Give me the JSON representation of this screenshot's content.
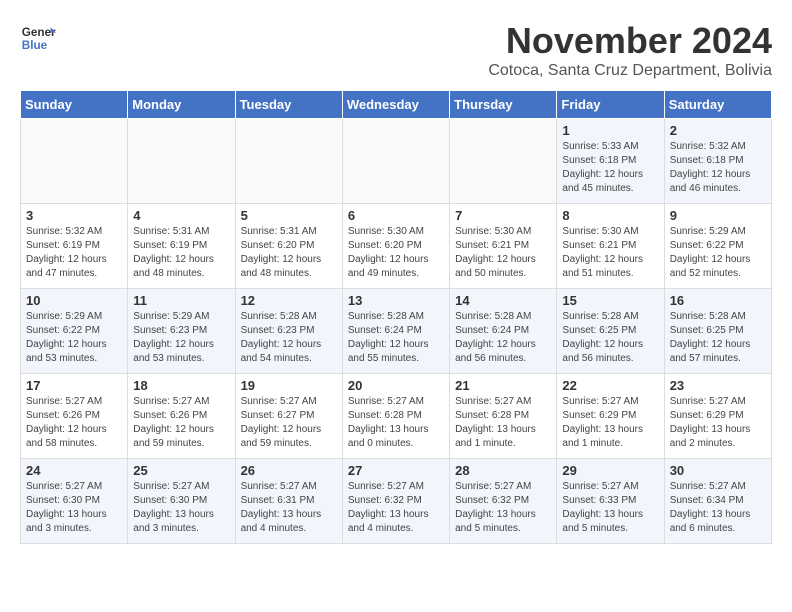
{
  "header": {
    "logo_line1": "General",
    "logo_line2": "Blue",
    "month_year": "November 2024",
    "location": "Cotoca, Santa Cruz Department, Bolivia"
  },
  "weekdays": [
    "Sunday",
    "Monday",
    "Tuesday",
    "Wednesday",
    "Thursday",
    "Friday",
    "Saturday"
  ],
  "weeks": [
    [
      {
        "day": "",
        "info": ""
      },
      {
        "day": "",
        "info": ""
      },
      {
        "day": "",
        "info": ""
      },
      {
        "day": "",
        "info": ""
      },
      {
        "day": "",
        "info": ""
      },
      {
        "day": "1",
        "info": "Sunrise: 5:33 AM\nSunset: 6:18 PM\nDaylight: 12 hours and 45 minutes."
      },
      {
        "day": "2",
        "info": "Sunrise: 5:32 AM\nSunset: 6:18 PM\nDaylight: 12 hours and 46 minutes."
      }
    ],
    [
      {
        "day": "3",
        "info": "Sunrise: 5:32 AM\nSunset: 6:19 PM\nDaylight: 12 hours and 47 minutes."
      },
      {
        "day": "4",
        "info": "Sunrise: 5:31 AM\nSunset: 6:19 PM\nDaylight: 12 hours and 48 minutes."
      },
      {
        "day": "5",
        "info": "Sunrise: 5:31 AM\nSunset: 6:20 PM\nDaylight: 12 hours and 48 minutes."
      },
      {
        "day": "6",
        "info": "Sunrise: 5:30 AM\nSunset: 6:20 PM\nDaylight: 12 hours and 49 minutes."
      },
      {
        "day": "7",
        "info": "Sunrise: 5:30 AM\nSunset: 6:21 PM\nDaylight: 12 hours and 50 minutes."
      },
      {
        "day": "8",
        "info": "Sunrise: 5:30 AM\nSunset: 6:21 PM\nDaylight: 12 hours and 51 minutes."
      },
      {
        "day": "9",
        "info": "Sunrise: 5:29 AM\nSunset: 6:22 PM\nDaylight: 12 hours and 52 minutes."
      }
    ],
    [
      {
        "day": "10",
        "info": "Sunrise: 5:29 AM\nSunset: 6:22 PM\nDaylight: 12 hours and 53 minutes."
      },
      {
        "day": "11",
        "info": "Sunrise: 5:29 AM\nSunset: 6:23 PM\nDaylight: 12 hours and 53 minutes."
      },
      {
        "day": "12",
        "info": "Sunrise: 5:28 AM\nSunset: 6:23 PM\nDaylight: 12 hours and 54 minutes."
      },
      {
        "day": "13",
        "info": "Sunrise: 5:28 AM\nSunset: 6:24 PM\nDaylight: 12 hours and 55 minutes."
      },
      {
        "day": "14",
        "info": "Sunrise: 5:28 AM\nSunset: 6:24 PM\nDaylight: 12 hours and 56 minutes."
      },
      {
        "day": "15",
        "info": "Sunrise: 5:28 AM\nSunset: 6:25 PM\nDaylight: 12 hours and 56 minutes."
      },
      {
        "day": "16",
        "info": "Sunrise: 5:28 AM\nSunset: 6:25 PM\nDaylight: 12 hours and 57 minutes."
      }
    ],
    [
      {
        "day": "17",
        "info": "Sunrise: 5:27 AM\nSunset: 6:26 PM\nDaylight: 12 hours and 58 minutes."
      },
      {
        "day": "18",
        "info": "Sunrise: 5:27 AM\nSunset: 6:26 PM\nDaylight: 12 hours and 59 minutes."
      },
      {
        "day": "19",
        "info": "Sunrise: 5:27 AM\nSunset: 6:27 PM\nDaylight: 12 hours and 59 minutes."
      },
      {
        "day": "20",
        "info": "Sunrise: 5:27 AM\nSunset: 6:28 PM\nDaylight: 13 hours and 0 minutes."
      },
      {
        "day": "21",
        "info": "Sunrise: 5:27 AM\nSunset: 6:28 PM\nDaylight: 13 hours and 1 minute."
      },
      {
        "day": "22",
        "info": "Sunrise: 5:27 AM\nSunset: 6:29 PM\nDaylight: 13 hours and 1 minute."
      },
      {
        "day": "23",
        "info": "Sunrise: 5:27 AM\nSunset: 6:29 PM\nDaylight: 13 hours and 2 minutes."
      }
    ],
    [
      {
        "day": "24",
        "info": "Sunrise: 5:27 AM\nSunset: 6:30 PM\nDaylight: 13 hours and 3 minutes."
      },
      {
        "day": "25",
        "info": "Sunrise: 5:27 AM\nSunset: 6:30 PM\nDaylight: 13 hours and 3 minutes."
      },
      {
        "day": "26",
        "info": "Sunrise: 5:27 AM\nSunset: 6:31 PM\nDaylight: 13 hours and 4 minutes."
      },
      {
        "day": "27",
        "info": "Sunrise: 5:27 AM\nSunset: 6:32 PM\nDaylight: 13 hours and 4 minutes."
      },
      {
        "day": "28",
        "info": "Sunrise: 5:27 AM\nSunset: 6:32 PM\nDaylight: 13 hours and 5 minutes."
      },
      {
        "day": "29",
        "info": "Sunrise: 5:27 AM\nSunset: 6:33 PM\nDaylight: 13 hours and 5 minutes."
      },
      {
        "day": "30",
        "info": "Sunrise: 5:27 AM\nSunset: 6:34 PM\nDaylight: 13 hours and 6 minutes."
      }
    ]
  ]
}
